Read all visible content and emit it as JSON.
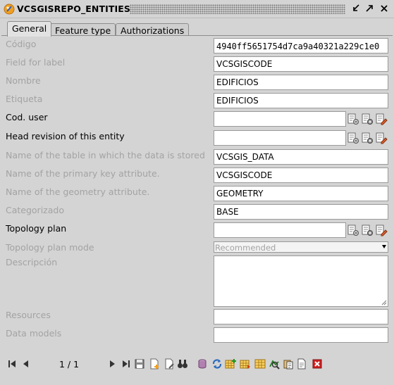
{
  "window": {
    "title": "VCSGISREPO_ENTITIES"
  },
  "tabs": [
    {
      "label": "General",
      "active": true
    },
    {
      "label": "Feature type",
      "active": false
    },
    {
      "label": "Authorizations",
      "active": false
    }
  ],
  "form": {
    "codigo": {
      "label": "Código",
      "value": "4940ff5651754d7ca9a40321a229c1e0"
    },
    "field_for_label": {
      "label": "Field for label",
      "value": "VCSGISCODE"
    },
    "nombre": {
      "label": "Nombre",
      "value": "EDIFICIOS"
    },
    "etiqueta": {
      "label": "Etiqueta",
      "value": "EDIFICIOS"
    },
    "cod_user": {
      "label": "Cod. user",
      "value": ""
    },
    "head_revision": {
      "label": "Head revision of this entity",
      "value": ""
    },
    "table_name": {
      "label": "Name of the table in which the data is stored",
      "value": "VCSGIS_DATA"
    },
    "pk_attribute": {
      "label": "Name of the primary key attribute.",
      "value": "VCSGISCODE"
    },
    "geometry_attribute": {
      "label": "Name of the geometry attribute.",
      "value": "GEOMETRY"
    },
    "categorizado": {
      "label": "Categorizado",
      "value": "BASE"
    },
    "topology_plan": {
      "label": "Topology plan",
      "value": ""
    },
    "topology_plan_mode": {
      "label": "Topology plan mode",
      "value": "Recommended"
    },
    "descripcion": {
      "label": "Descripción",
      "value": ""
    },
    "resources": {
      "label": "Resources",
      "value": ""
    },
    "data_models": {
      "label": "Data models",
      "value": ""
    }
  },
  "pager": {
    "text": "1 / 1"
  },
  "colors": {
    "background": "#d4d4d4",
    "disabled_label": "#a3a3a3",
    "accent_orange": "#f0a020",
    "delete_red": "#d02020"
  }
}
